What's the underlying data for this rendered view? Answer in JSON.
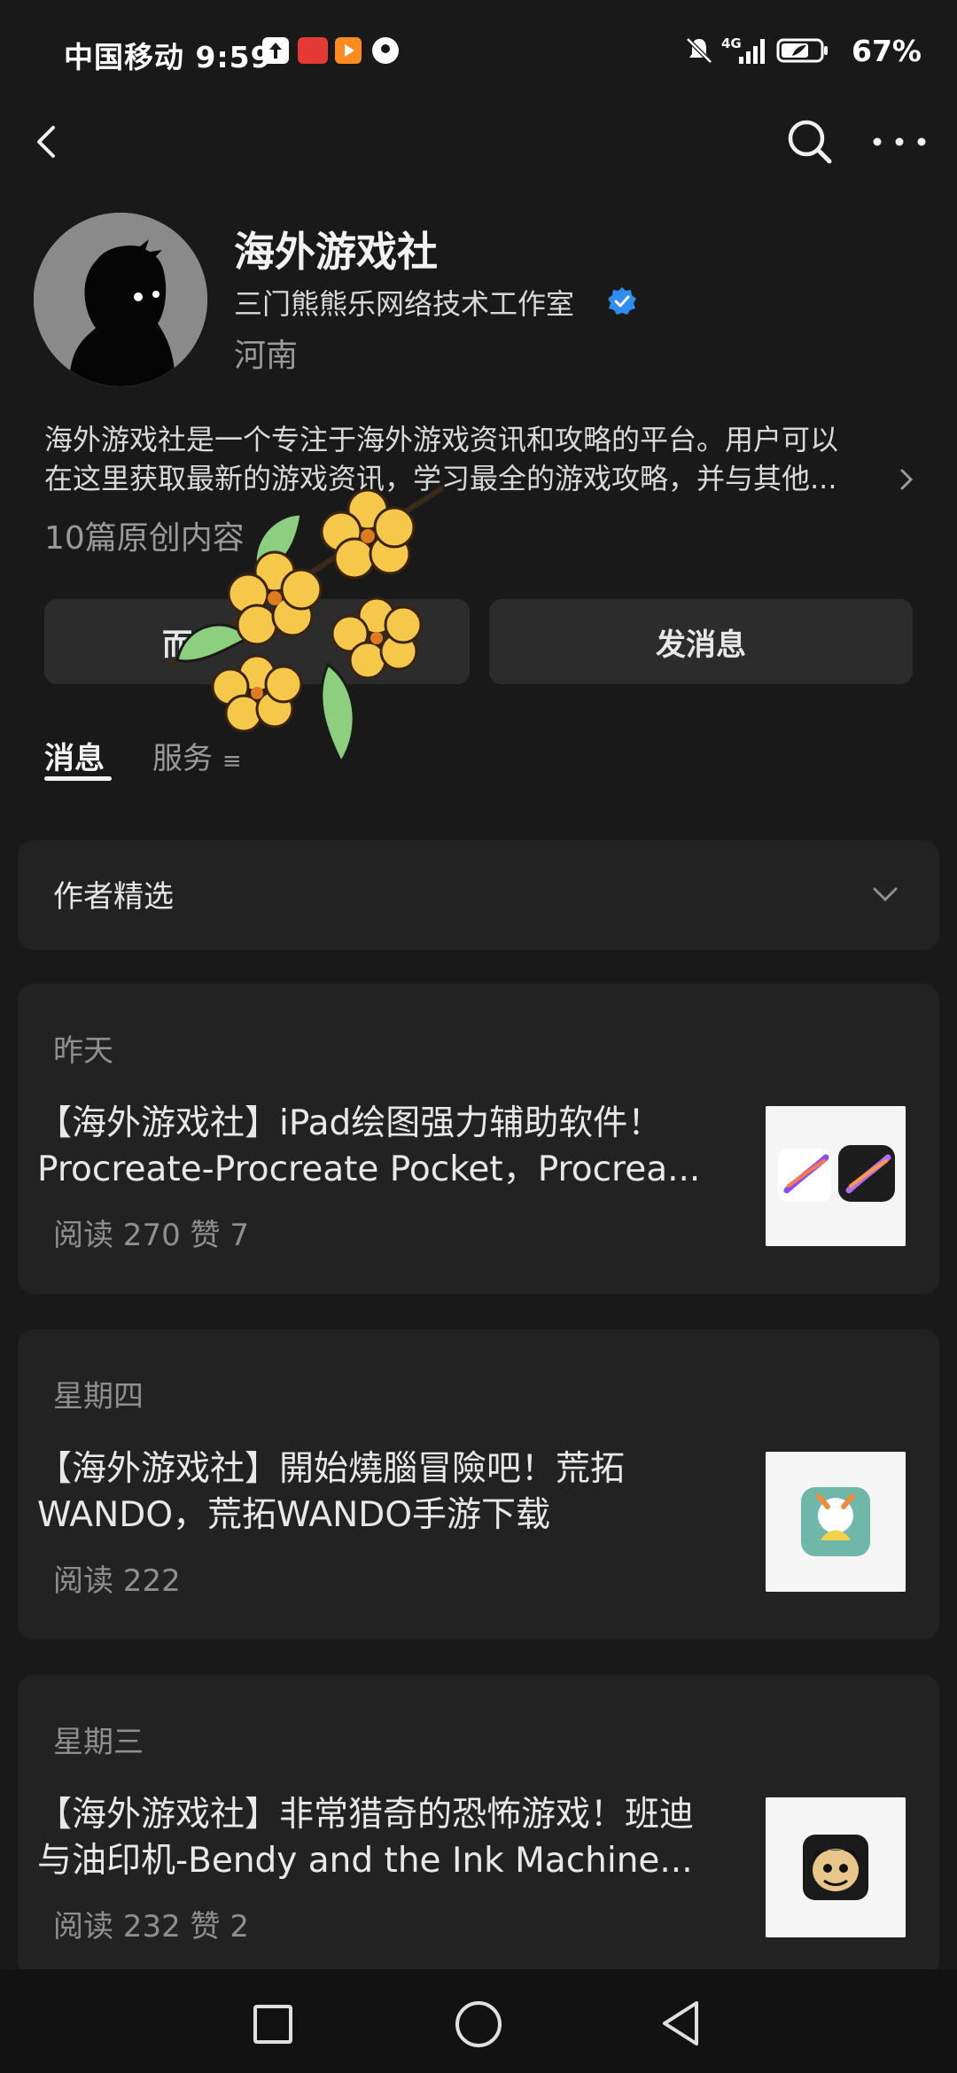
{
  "status_bar": {
    "carrier_time": "中国移动 9:59",
    "battery": "67%",
    "network": "4G"
  },
  "profile": {
    "name": "海外游戏社",
    "organization": "三门熊熊乐网络技术工作室",
    "region": "河南",
    "description_line1": "海外游戏社是一个专注于海外游戏资讯和攻略的平台。用户可以",
    "description_line2": "在这里获取最新的游戏资讯，学习最全的游戏攻略，并与其他...",
    "original_count": "10篇原创内容"
  },
  "actions": {
    "left_button": "而",
    "right_button": "发消息"
  },
  "tabs": {
    "messages": "消息",
    "services": "服务"
  },
  "author_section": {
    "label": "作者精选"
  },
  "articles": [
    {
      "date": "昨天",
      "title_line1": "【海外游戏社】iPad绘图强力辅助软件！",
      "title_line2": "Procreate-Procreate Pocket，Procrea...",
      "stats": "阅读 270  赞 7"
    },
    {
      "date": "星期四",
      "title_line1": "【海外游戏社】開始燒腦冒險吧！荒拓",
      "title_line2": "WANDO，荒拓WANDO手游下载",
      "stats": "阅读 222"
    },
    {
      "date": "星期三",
      "title_line1": "【海外游戏社】非常猎奇的恐怖游戏！班迪",
      "title_line2": "与油印机-Bendy and the Ink Machine...",
      "stats": "阅读 232  赞 2"
    }
  ],
  "icons": {
    "back": "back-arrow-icon",
    "search": "search-icon",
    "more": "more-icon",
    "verified": "verified-badge-icon"
  },
  "colors": {
    "background": "#191919",
    "card": "#222222",
    "verified": "#2f8cf0"
  }
}
